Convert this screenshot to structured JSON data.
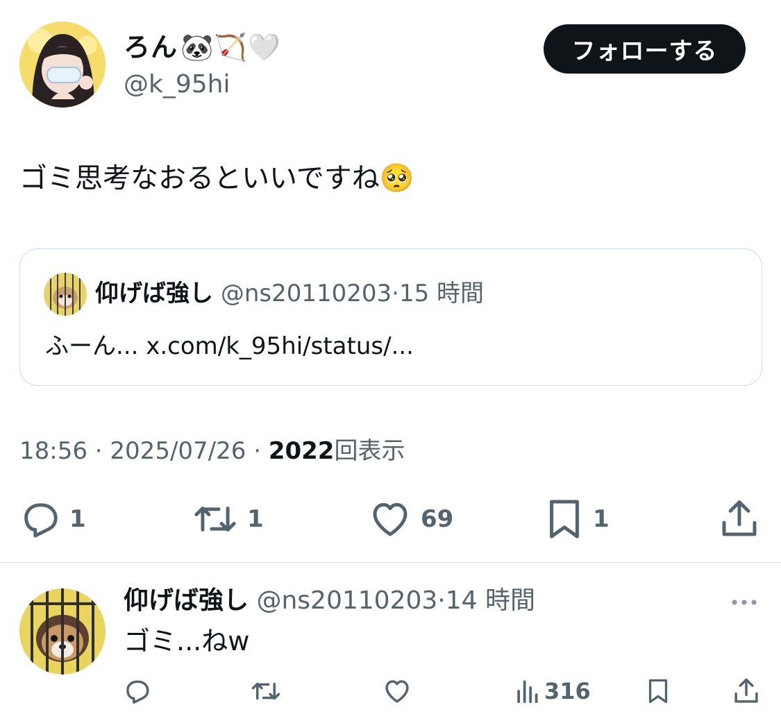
{
  "tweet": {
    "author": {
      "display_name": "ろん",
      "name_emojis": "🐼🏹🤍",
      "handle": "@k_95hi"
    },
    "follow_label": "フォローする",
    "text": "ゴミ思考なおるといいですね",
    "text_emoji": "🥺",
    "quote": {
      "display_name": "仰げば強し",
      "handle": "@ns20110203",
      "separator": "·",
      "time": "15 時間",
      "body": "ふーん... x.com/k_95hi/status/..."
    },
    "meta": {
      "time": "18:56",
      "separator": "·",
      "date": "2025/07/26",
      "views_count": "2022",
      "views_label": "回表示"
    },
    "actions": {
      "replies": "1",
      "reposts": "1",
      "likes": "69",
      "bookmarks": "1"
    }
  },
  "reply": {
    "display_name": "仰げば強し",
    "handle": "@ns20110203",
    "separator": "·",
    "time": "14 時間",
    "text": "ゴミ...ねw",
    "views": "316"
  },
  "colors": {
    "text": "#0f1419",
    "secondary": "#536471",
    "border": "#cfd9de",
    "button": "#0f1419"
  },
  "icons": [
    "reply-icon",
    "repost-icon",
    "like-icon",
    "bookmark-icon",
    "share-icon",
    "views-icon",
    "more-icon"
  ]
}
